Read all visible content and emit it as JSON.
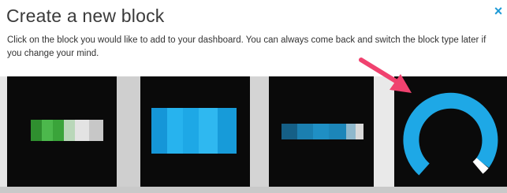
{
  "dialog": {
    "title": "Create a new block",
    "close_label": "×",
    "description": "Click on the block you would like to add to your dashboard. You can always come back and switch the block type later if you change your mind."
  },
  "blocks": [
    {
      "type": "bar-green",
      "bar_color": "#3aa43a",
      "accent_color": "#d9d9d9"
    },
    {
      "type": "bar-blue",
      "bar_color": "#1ea8e6"
    },
    {
      "type": "bar-thin-blue",
      "bar_color": "#1b7fb0",
      "accent_color": "#d9d9d9"
    },
    {
      "type": "gauge",
      "arc_color": "#1ea8e6",
      "accent_color": "#ffffff"
    }
  ],
  "annotation": {
    "icon": "arrow-pointer-icon",
    "color": "#f0426f"
  },
  "colors": {
    "accent": "#1e9ad6"
  }
}
